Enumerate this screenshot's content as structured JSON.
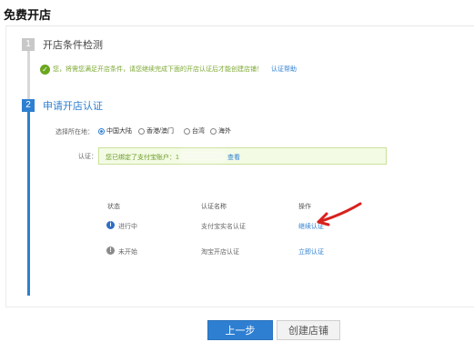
{
  "page": {
    "title": "免费开店"
  },
  "step1": {
    "number": "1",
    "title": "开店条件检测"
  },
  "notice": {
    "text": "您，将需您满足开店条件，请您继续完成下面的开店认证后才能创建店铺！",
    "link": "认证帮助"
  },
  "step2": {
    "number": "2",
    "title": "申请开店认证"
  },
  "region": {
    "label": "选择所在地：",
    "options": [
      {
        "label": "中国大陆",
        "selected": true
      },
      {
        "label": "香港/澳门",
        "selected": false
      },
      {
        "label": "台湾",
        "selected": false
      },
      {
        "label": "海外",
        "selected": false
      }
    ]
  },
  "certification": {
    "label": "认证：",
    "text": "您已绑定了支付宝账户：1",
    "link": "查看"
  },
  "table": {
    "headers": [
      "状态",
      "认证名称",
      "操作"
    ],
    "rows": [
      {
        "status_icon": "info-icon",
        "status": "进行中",
        "name": "支付宝实名认证",
        "action": "继续认证"
      },
      {
        "status_icon": "pending-icon",
        "status": "未开始",
        "name": "淘宝开店认证",
        "action": "立即认证"
      }
    ]
  },
  "buttons": {
    "prev": "上一步",
    "create": "创建店铺"
  },
  "colors": {
    "primary": "#2e7fd1",
    "success": "#6aa71f",
    "annotation": "#d8201e"
  }
}
